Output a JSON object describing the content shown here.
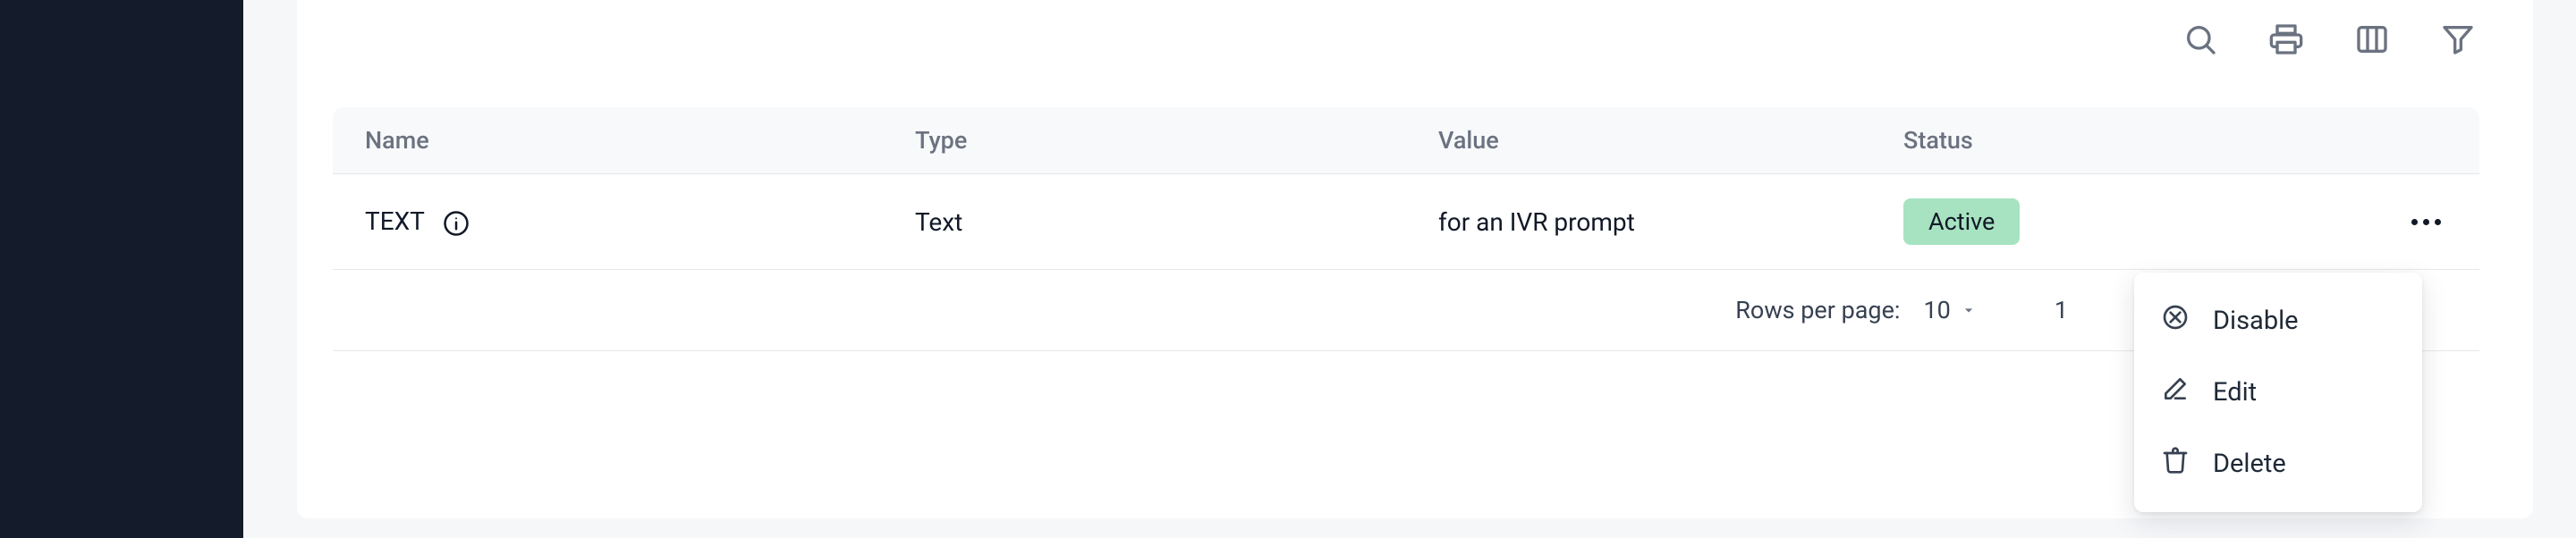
{
  "toolbar": {
    "search_icon": "search",
    "print_icon": "print",
    "columns_icon": "columns",
    "filter_icon": "filter"
  },
  "table": {
    "headers": {
      "name": "Name",
      "type": "Type",
      "value": "Value",
      "status": "Status"
    },
    "rows": [
      {
        "name": "TEXT",
        "info_icon": "info",
        "type": "Text",
        "value": "for an IVR prompt",
        "status": "Active",
        "status_color": "#a7e3c1"
      }
    ]
  },
  "pagination": {
    "rows_per_page_label": "Rows per page:",
    "rows_per_page_value": "10",
    "page_range_start": "1"
  },
  "row_menu": {
    "items": [
      {
        "icon": "disable",
        "label": "Disable"
      },
      {
        "icon": "edit",
        "label": "Edit"
      },
      {
        "icon": "delete",
        "label": "Delete"
      }
    ]
  }
}
